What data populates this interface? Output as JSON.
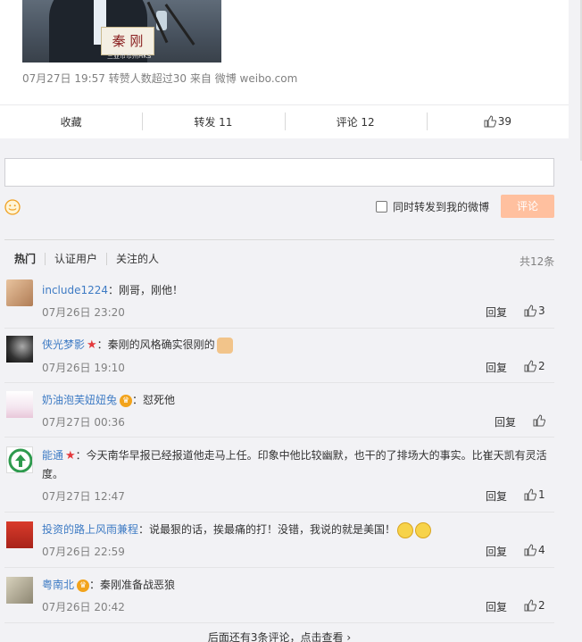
{
  "post": {
    "photo_name_tag": "秦 刚",
    "photo_watermark": "三亚市市州HKS",
    "timestamp": "07月27日 19:57",
    "repost_note": "转赞人数超过30",
    "source_prefix": "来自",
    "source": "微博 weibo.com"
  },
  "actions": {
    "favorite": "收藏",
    "forward": "转发 11",
    "comment": "评论 12",
    "like_count": "39"
  },
  "composer": {
    "input_value": "",
    "forward_label": "同时转发到我的微博",
    "submit_label": "评论"
  },
  "tabs": [
    "热门",
    "认证用户",
    "关注的人"
  ],
  "total": "共12条",
  "comments": [
    {
      "user": "include1224",
      "text": "：刚哥，刚他！",
      "time": "07月26日 23:20",
      "reply": "回复",
      "likes": "3",
      "badge": ""
    },
    {
      "user": "侠光梦影",
      "text": "：秦刚的风格确实很刚的",
      "time": "07月26日 19:10",
      "reply": "回复",
      "likes": "2",
      "badge": "star"
    },
    {
      "user": "奶油泡芙妞妞兔",
      "text": "：怼死他",
      "time": "07月27日 00:36",
      "reply": "回复",
      "likes": "",
      "badge": "crown"
    },
    {
      "user": "能通",
      "text": "：今天南华早报已经报道他走马上任。印象中他比较幽默，也干的了排场大的事实。比崔天凯有灵活度。",
      "time": "07月27日 12:47",
      "reply": "回复",
      "likes": "1",
      "badge": "star"
    },
    {
      "user": "投资的路上风雨兼程",
      "text": "：说最狠的话，挨最痛的打！没错，我说的就是美国！",
      "time": "07月26日 22:59",
      "reply": "回复",
      "likes": "4",
      "badge": ""
    },
    {
      "user": "粤南北",
      "text": "：秦刚准备战恶狼",
      "time": "07月26日 20:42",
      "reply": "回复",
      "likes": "2",
      "badge": "crown"
    }
  ],
  "more": "后面还有3条评论，点击查看 ›",
  "colors": {
    "link": "#3e7bc4",
    "submit_disabled": "#ffc09f",
    "star": "#e4393c",
    "crown": "#f2a31b"
  }
}
